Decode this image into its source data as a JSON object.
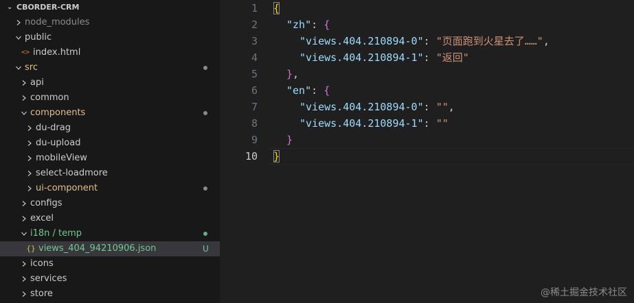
{
  "explorer": {
    "project": "CBORDER-CRM",
    "items": [
      {
        "label": "node_modules",
        "depth": 0,
        "type": "folder",
        "open": false,
        "color": "#8b8b8b",
        "dot": false
      },
      {
        "label": "public",
        "depth": 0,
        "type": "folder",
        "open": true,
        "color": "#cccccc",
        "dot": false
      },
      {
        "label": "index.html",
        "depth": 1,
        "type": "html",
        "color": "#cccccc",
        "dot": false
      },
      {
        "label": "src",
        "depth": 0,
        "type": "folder",
        "open": true,
        "color": "#e2c08d",
        "dot": true
      },
      {
        "label": "api",
        "depth": 1,
        "type": "folder",
        "open": false,
        "color": "#cccccc",
        "dot": false
      },
      {
        "label": "common",
        "depth": 1,
        "type": "folder",
        "open": false,
        "color": "#cccccc",
        "dot": false
      },
      {
        "label": "components",
        "depth": 1,
        "type": "folder",
        "open": true,
        "color": "#e2c08d",
        "dot": true
      },
      {
        "label": "du-drag",
        "depth": 2,
        "type": "folder",
        "open": false,
        "color": "#cccccc",
        "dot": false
      },
      {
        "label": "du-upload",
        "depth": 2,
        "type": "folder",
        "open": false,
        "color": "#cccccc",
        "dot": false
      },
      {
        "label": "mobileView",
        "depth": 2,
        "type": "folder",
        "open": false,
        "color": "#cccccc",
        "dot": false
      },
      {
        "label": "select-loadmore",
        "depth": 2,
        "type": "folder",
        "open": false,
        "color": "#cccccc",
        "dot": false
      },
      {
        "label": "ui-component",
        "depth": 2,
        "type": "folder",
        "open": false,
        "color": "#e2c08d",
        "dot": true
      },
      {
        "label": "configs",
        "depth": 1,
        "type": "folder",
        "open": false,
        "color": "#cccccc",
        "dot": false
      },
      {
        "label": "excel",
        "depth": 1,
        "type": "folder",
        "open": false,
        "color": "#cccccc",
        "dot": false
      },
      {
        "label": "i18n / temp",
        "depth": 1,
        "type": "folder",
        "open": true,
        "color": "#73c991",
        "dot": true,
        "dotGreen": true
      },
      {
        "label": "views_404_94210906.json",
        "depth": 2,
        "type": "json",
        "color": "#73c991",
        "selected": true,
        "badge": "U"
      },
      {
        "label": "icons",
        "depth": 1,
        "type": "folder",
        "open": false,
        "color": "#cccccc",
        "dot": false
      },
      {
        "label": "services",
        "depth": 1,
        "type": "folder",
        "open": false,
        "color": "#cccccc",
        "dot": false
      },
      {
        "label": "store",
        "depth": 1,
        "type": "folder",
        "open": false,
        "color": "#cccccc",
        "dot": false
      }
    ]
  },
  "editor": {
    "active_line": 10,
    "line_numbers": [
      "1",
      "2",
      "3",
      "4",
      "5",
      "6",
      "7",
      "8",
      "9",
      "10"
    ],
    "lines": [
      {
        "indent": 0,
        "tokens": [
          {
            "t": "{",
            "c": "brace-gold"
          }
        ]
      },
      {
        "indent": 1,
        "tokens": [
          {
            "t": "\"zh\"",
            "c": "str-key"
          },
          {
            "t": ": ",
            "c": "punct"
          },
          {
            "t": "{",
            "c": "brace-pink"
          }
        ]
      },
      {
        "indent": 2,
        "tokens": [
          {
            "t": "\"views.404.210894-0\"",
            "c": "str-key"
          },
          {
            "t": ": ",
            "c": "punct"
          },
          {
            "t": "\"页面跑到火星去了……\"",
            "c": "str-val"
          },
          {
            "t": ",",
            "c": "punct"
          }
        ]
      },
      {
        "indent": 2,
        "tokens": [
          {
            "t": "\"views.404.210894-1\"",
            "c": "str-key"
          },
          {
            "t": ": ",
            "c": "punct"
          },
          {
            "t": "\"返回\"",
            "c": "str-val"
          }
        ]
      },
      {
        "indent": 1,
        "tokens": [
          {
            "t": "}",
            "c": "brace-pink"
          },
          {
            "t": ",",
            "c": "punct"
          }
        ]
      },
      {
        "indent": 1,
        "tokens": [
          {
            "t": "\"en\"",
            "c": "str-key"
          },
          {
            "t": ": ",
            "c": "punct"
          },
          {
            "t": "{",
            "c": "brace-pink"
          }
        ]
      },
      {
        "indent": 2,
        "tokens": [
          {
            "t": "\"views.404.210894-0\"",
            "c": "str-key"
          },
          {
            "t": ": ",
            "c": "punct"
          },
          {
            "t": "\"\"",
            "c": "str-val"
          },
          {
            "t": ",",
            "c": "punct"
          }
        ]
      },
      {
        "indent": 2,
        "tokens": [
          {
            "t": "\"views.404.210894-1\"",
            "c": "str-key"
          },
          {
            "t": ": ",
            "c": "punct"
          },
          {
            "t": "\"\"",
            "c": "str-val"
          }
        ]
      },
      {
        "indent": 1,
        "tokens": [
          {
            "t": "}",
            "c": "brace-pink"
          }
        ]
      },
      {
        "indent": 0,
        "tokens": [
          {
            "t": "}",
            "c": "brace-gold"
          }
        ]
      }
    ]
  },
  "watermark": "@稀土掘金技术社区",
  "colors": {
    "sidebar_bg": "#181818",
    "editor_bg": "#1f1f1f",
    "key": "#9cdcfe",
    "string": "#ce9178",
    "brace_outer": "#ffd700",
    "brace_inner": "#da70d6",
    "git_modified": "#e2c08d",
    "git_untracked": "#73c991"
  }
}
